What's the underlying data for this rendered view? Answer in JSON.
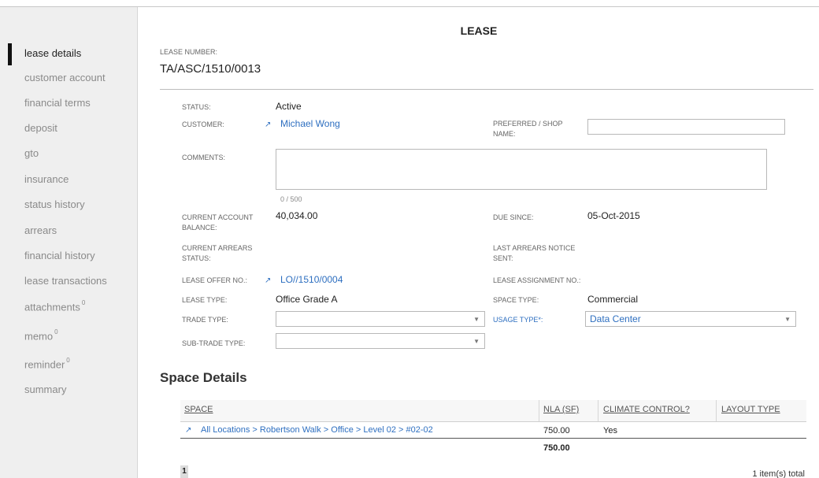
{
  "sidebar": {
    "items": [
      {
        "label": "lease details",
        "badge": ""
      },
      {
        "label": "customer account",
        "badge": ""
      },
      {
        "label": "financial terms",
        "badge": ""
      },
      {
        "label": "deposit",
        "badge": ""
      },
      {
        "label": "gto",
        "badge": ""
      },
      {
        "label": "insurance",
        "badge": ""
      },
      {
        "label": "status history",
        "badge": ""
      },
      {
        "label": "arrears",
        "badge": ""
      },
      {
        "label": "financial history",
        "badge": ""
      },
      {
        "label": "lease transactions",
        "badge": ""
      },
      {
        "label": "attachments",
        "badge": "0"
      },
      {
        "label": "memo",
        "badge": "0"
      },
      {
        "label": "reminder",
        "badge": "0"
      },
      {
        "label": "summary",
        "badge": ""
      }
    ]
  },
  "header": {
    "title": "LEASE",
    "lease_number_label": "LEASE NUMBER:",
    "lease_number": "TA/ASC/1510/0013"
  },
  "form": {
    "status_label": "STATUS:",
    "status": "Active",
    "customer_label": "CUSTOMER:",
    "customer": "Michael Wong",
    "preferred_label": "PREFERRED / SHOP NAME:",
    "preferred_value": "",
    "comments_label": "COMMENTS:",
    "comments_value": "",
    "comments_counter": "0 / 500",
    "balance_label": "CURRENT ACCOUNT BALANCE:",
    "balance": "40,034.00",
    "due_since_label": "DUE SINCE:",
    "due_since": "05-Oct-2015",
    "arrears_status_label": "CURRENT ARREARS STATUS:",
    "arrears_status": "",
    "last_notice_label": "LAST ARREARS NOTICE SENT:",
    "last_notice": "",
    "lease_offer_label": "LEASE OFFER NO.:",
    "lease_offer": "LO//1510/0004",
    "assignment_label": "LEASE ASSIGNMENT NO.:",
    "assignment": "",
    "lease_type_label": "LEASE TYPE:",
    "lease_type": "Office Grade A",
    "space_type_label": "SPACE TYPE:",
    "space_type": "Commercial",
    "trade_type_label": "TRADE TYPE:",
    "trade_type": "",
    "usage_type_label": "USAGE TYPE*:",
    "usage_type": "Data Center",
    "sub_trade_label": "SUB-TRADE TYPE:",
    "sub_trade": ""
  },
  "space_details": {
    "title": "Space Details",
    "columns": [
      "SPACE",
      "NLA (SF)",
      "CLIMATE CONTROL?",
      "LAYOUT TYPE"
    ],
    "rows": [
      {
        "space": "All Locations > Robertson Walk > Office > Level 02 > #02-02",
        "nla": "750.00",
        "climate": "Yes",
        "layout": ""
      }
    ],
    "total_nla": "750.00",
    "page": "1",
    "total_text": "1 item(s) total"
  },
  "icons": {
    "external_link": "external-link-icon",
    "dropdown": "chevron-down-icon"
  },
  "colors": {
    "link": "#2e6fc0",
    "sidebar_bg": "#efefef"
  }
}
